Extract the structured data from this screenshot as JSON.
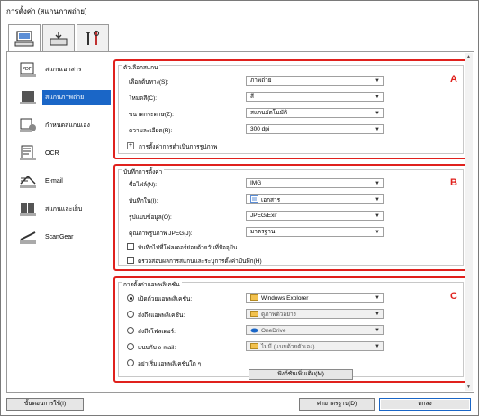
{
  "window": {
    "title": "การตั้งค่า (สแกนภาพถ่าย)"
  },
  "top_tabs": [
    {
      "icon": "scan-computer-icon"
    },
    {
      "icon": "scan-panel-icon"
    },
    {
      "icon": "tools-icon"
    }
  ],
  "sidebar": {
    "items": [
      {
        "label": "สแกนเอกสาร",
        "icon": "document-scan-icon"
      },
      {
        "label": "สแกนภาพถ่าย",
        "icon": "photo-scan-icon"
      },
      {
        "label": "กำหนดสแกนเอง",
        "icon": "custom-scan-icon"
      },
      {
        "label": "OCR",
        "icon": "ocr-icon"
      },
      {
        "label": "E-mail",
        "icon": "email-icon"
      },
      {
        "label": "สแกนและเย็บ",
        "icon": "stitch-icon"
      },
      {
        "label": "ScanGear",
        "icon": "scangear-icon"
      }
    ],
    "active_index": 1
  },
  "scan_options": {
    "title": "ตัวเลือกสแกน",
    "letter": "A",
    "rows": [
      {
        "label": "เลือกต้นทาง(S):",
        "value": "ภาพถ่าย"
      },
      {
        "label": "โหมดสี(C):",
        "value": "สี"
      },
      {
        "label": "ขนาดกระดาษ(Z):",
        "value": "สแกนอัตโนมัติ"
      },
      {
        "label": "ความละเอียด(R):",
        "value": "300 dpi"
      }
    ],
    "expand_label": "การตั้งค่าการดำเนินการรูปภาพ"
  },
  "save_settings": {
    "title": "บันทึกการตั้งค่า",
    "letter": "B",
    "rows": [
      {
        "label": "ชื่อไฟล์(N):",
        "value": "IMG"
      },
      {
        "label": "บันทึกใน(I):",
        "value": "เอกสาร"
      },
      {
        "label": "รูปแบบข้อมูล(O):",
        "value": "JPEG/Exif"
      },
      {
        "label": "คุณภาพรูปภาพ JPEG(J):",
        "value": "มาตรฐาน"
      }
    ],
    "checkbox1": "บันทึกไปที่โฟลเดอร์ย่อยด้วยวันที่ปัจจุบัน",
    "checkbox2": "ตรวจสอบผลการสแกนและระบุการตั้งค่าบันทึก(H)"
  },
  "app_settings": {
    "title": "การตั้งค่าแอพพลิเคชัน",
    "letter": "C",
    "rows": [
      {
        "label": "เปิดด้วยแอพพลิเคชัน:",
        "value": "Windows Explorer",
        "selected": true,
        "disabled": false,
        "icon": "explorer-icon"
      },
      {
        "label": "ส่งถึงแอพพลิเคชัน:",
        "value": "ดูภาพตัวอย่าง",
        "selected": false,
        "disabled": true,
        "icon": "folder-icon"
      },
      {
        "label": "ส่งถึงโฟลเดอร์:",
        "value": "OneDrive",
        "selected": false,
        "disabled": true,
        "icon": "onedrive-icon"
      },
      {
        "label": "แนบกับ e-mail:",
        "value": "ไม่มี (แนบด้วยตัวเอง)",
        "selected": false,
        "disabled": true,
        "icon": "folder-icon"
      }
    ],
    "no_app_label": "อย่าเริ่มแอพพลิเคชันใด ๆ",
    "more_functions": "ฟังก์ชันเพิ่มเติม(M)"
  },
  "footer": {
    "instructions": "ขั้นตอนการใช้(I)",
    "defaults": "ค่ามาตรฐาน(D)",
    "ok": "ตกลง"
  },
  "colors": {
    "accent": "#1a66c7",
    "highlight": "#e0211d"
  }
}
